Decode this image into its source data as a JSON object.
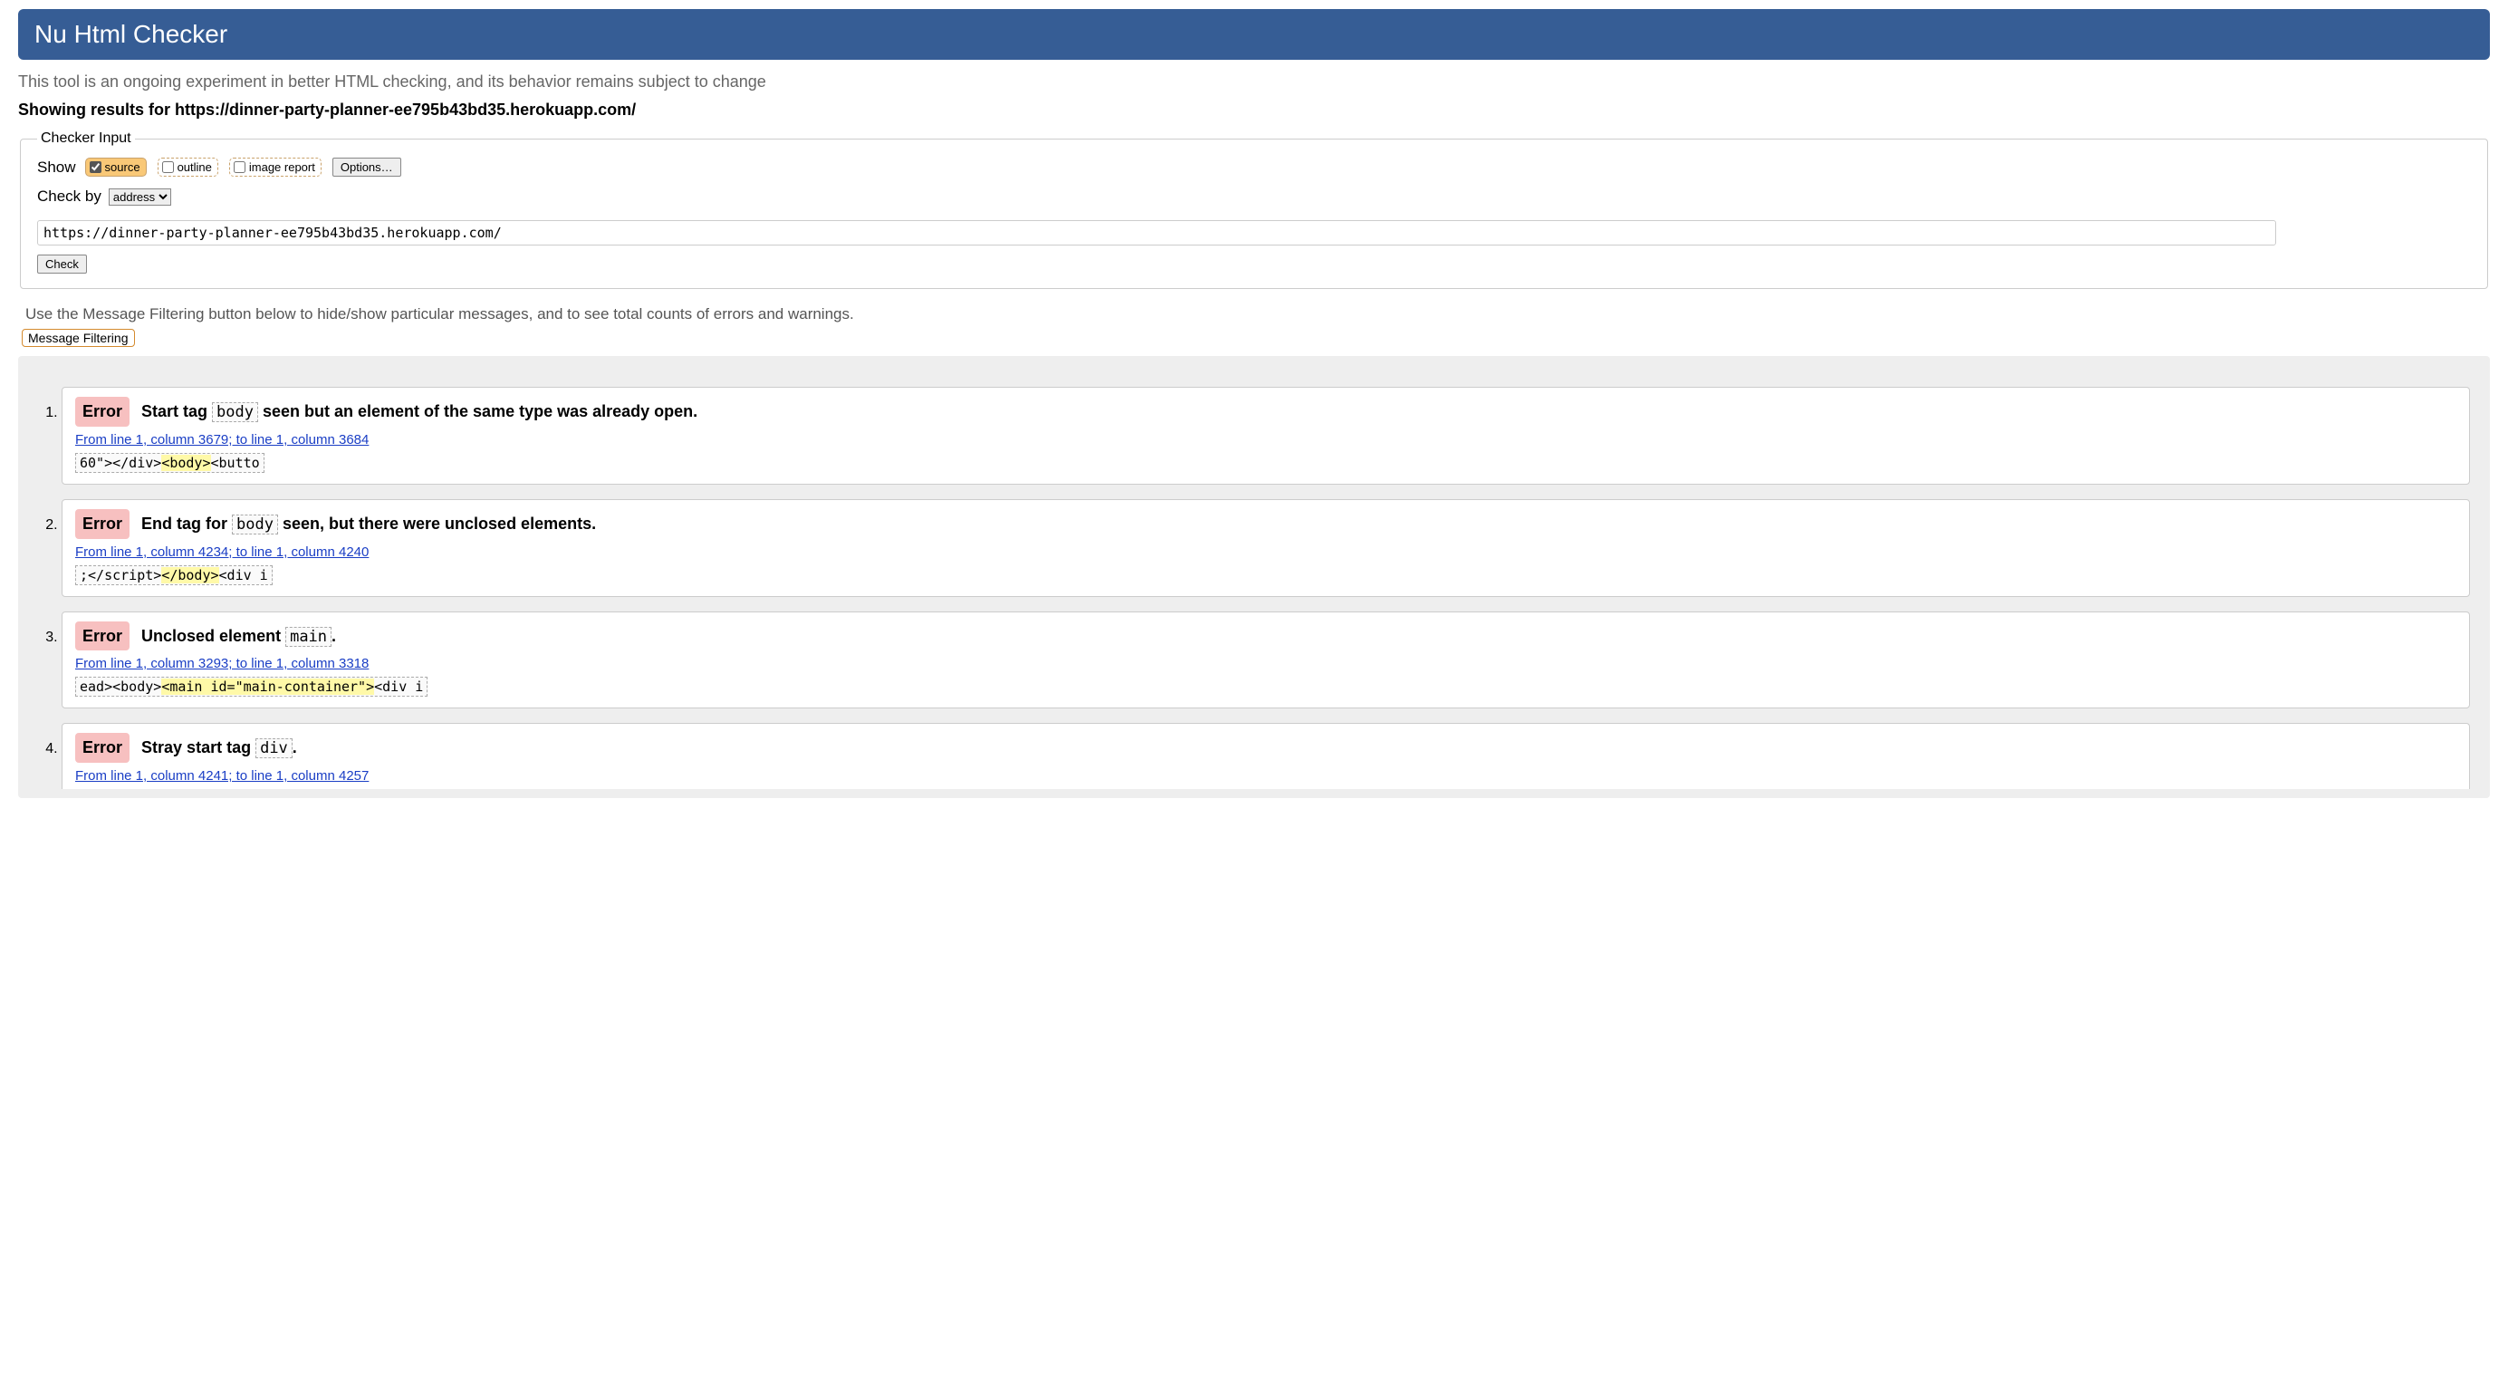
{
  "banner": {
    "title": "Nu Html Checker"
  },
  "tagline": "This tool is an ongoing experiment in better HTML checking, and its behavior remains subject to change",
  "results_for_prefix": "Showing results for ",
  "results_for_url": "https://dinner-party-planner-ee795b43bd35.herokuapp.com/",
  "checker_input": {
    "legend": "Checker Input",
    "show_label": "Show",
    "source_label": "source",
    "outline_label": "outline",
    "image_report_label": "image report",
    "options_label": "Options…",
    "check_by_label": "Check by",
    "check_by_value": "address",
    "url_value": "https://dinner-party-planner-ee795b43bd35.herokuapp.com/",
    "check_button": "Check"
  },
  "filter_hint": "Use the Message Filtering button below to hide/show particular messages, and to see total counts of errors and warnings.",
  "filter_button": "Message Filtering",
  "badge_error": "Error",
  "messages": [
    {
      "pre": "Start tag ",
      "tag": "body",
      "post": " seen but an element of the same type was already open.",
      "location": "From line 1, column 3679; to line 1, column 3684",
      "extract_pre": "60\"></div>",
      "extract_hl": "<body>",
      "extract_post": "<butto"
    },
    {
      "pre": "End tag for ",
      "tag": "body",
      "post": " seen, but there were unclosed elements.",
      "location": "From line 1, column 4234; to line 1, column 4240",
      "extract_pre": ";</script>",
      "extract_hl": "</body>",
      "extract_post": "<div i"
    },
    {
      "pre": "Unclosed element ",
      "tag": "main",
      "post": ".",
      "location": "From line 1, column 3293; to line 1, column 3318",
      "extract_pre": "ead><body>",
      "extract_hl": "<main id=\"main-container\">",
      "extract_post": "<div i"
    },
    {
      "pre": "Stray start tag ",
      "tag": "div",
      "post": ".",
      "location": "From line 1, column 4241; to line 1, column 4257",
      "extract_pre": "",
      "extract_hl": "",
      "extract_post": ""
    }
  ]
}
